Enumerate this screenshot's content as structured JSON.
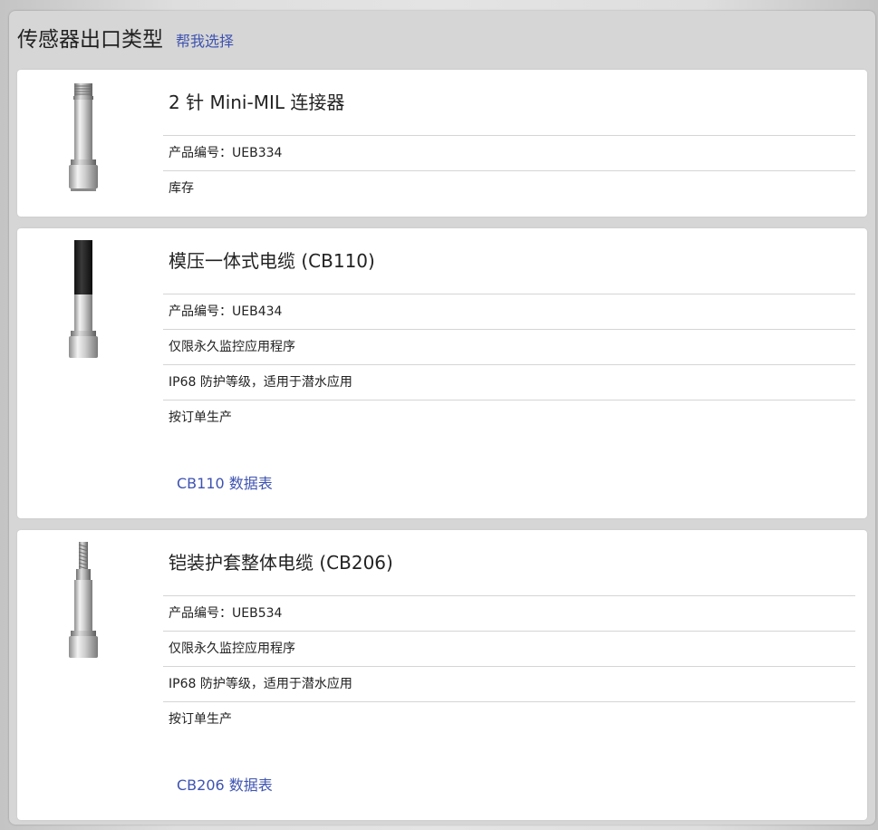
{
  "header": {
    "title": "传感器出口类型",
    "help_link": "帮我选择"
  },
  "products": [
    {
      "name": "2 针 Mini-MIL 连接器",
      "rows": [
        "产品编号：UEB334",
        "库存"
      ],
      "icon": "connector-sensor-icon"
    },
    {
      "name": "模压一体式电缆 (CB110)",
      "rows": [
        "产品编号：UEB434",
        "仅限永久监控应用程序",
        "IP68 防护等级，适用于潜水应用",
        "按订单生产"
      ],
      "datasheet": "CB110 数据表",
      "icon": "molded-cable-sensor-icon"
    },
    {
      "name": "铠装护套整体电缆 (CB206)",
      "rows": [
        "产品编号：UEB534",
        "仅限永久监控应用程序",
        "IP68 防护等级，适用于潜水应用",
        "按订单生产"
      ],
      "datasheet": "CB206 数据表",
      "icon": "armored-cable-sensor-icon"
    }
  ],
  "colors": {
    "link": "#3e53b0",
    "panel": "#d6d6d6",
    "card": "#ffffff",
    "divider": "#d5d5d5"
  }
}
